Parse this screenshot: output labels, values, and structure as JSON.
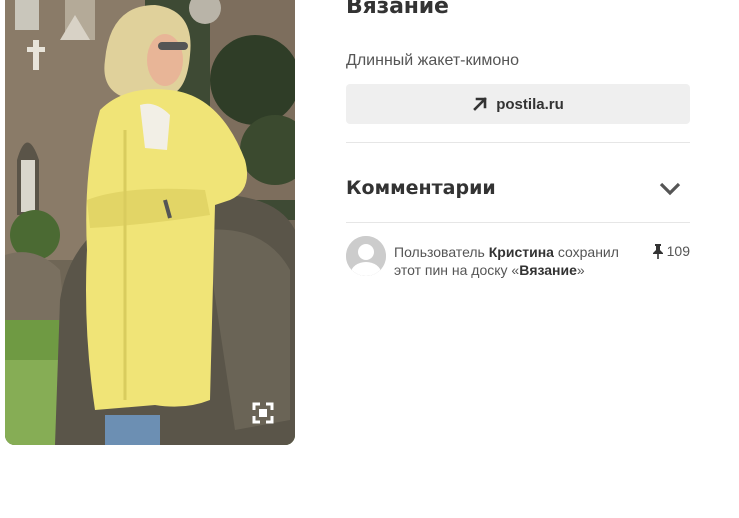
{
  "pin": {
    "image_alt": "Женщина в длинном жёлтом вязаном жакете-кимоно",
    "expand_icon": "expand-icon"
  },
  "details": {
    "board_title": "Вязание",
    "description": "Длинный жакет-кимоно",
    "source": {
      "icon": "arrow-up-right-icon",
      "label": "postila.ru"
    },
    "comments": {
      "title": "Комментарии",
      "toggle_icon": "chevron-down-icon"
    },
    "saver": {
      "prefix": "Пользователь ",
      "user_name": "Кристина",
      "middle": " сохранил этот пин на доску «",
      "board_name": "Вязание",
      "suffix": "»",
      "avatar_icon": "user-avatar-icon",
      "pin_icon": "pushpin-icon",
      "save_count": "109"
    }
  }
}
